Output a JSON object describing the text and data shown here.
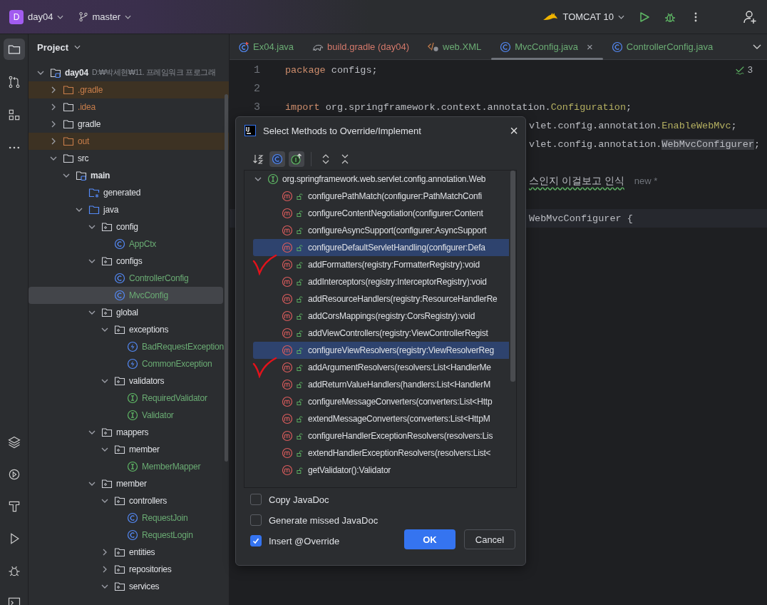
{
  "title_bar": {
    "project_badge": "D",
    "project": "day04",
    "branch": "master",
    "run_config": "TOMCAT 10"
  },
  "project_panel": {
    "title": "Project",
    "tree": [
      {
        "label": "day04",
        "kind": "module",
        "expanded": true,
        "hint": "D:₩박세현₩11. 프레임워크 프로그래",
        "selected": false,
        "excluded": false,
        "ignored": false,
        "added": false,
        "children": [
          {
            "label": ".gradle",
            "kind": "folder",
            "expanded": false,
            "selected": false,
            "excluded": true,
            "ignored": false,
            "added": false
          },
          {
            "label": ".idea",
            "kind": "folder",
            "expanded": false,
            "selected": false,
            "excluded": false,
            "ignored": true,
            "added": false
          },
          {
            "label": "gradle",
            "kind": "folder",
            "expanded": false,
            "selected": false,
            "excluded": false,
            "ignored": false,
            "added": false
          },
          {
            "label": "out",
            "kind": "folder",
            "expanded": false,
            "selected": false,
            "excluded": true,
            "ignored": false,
            "added": false
          },
          {
            "label": "src",
            "kind": "folder",
            "expanded": true,
            "selected": false,
            "excluded": false,
            "ignored": false,
            "added": false,
            "children": [
              {
                "label": "main",
                "kind": "module",
                "expanded": true,
                "selected": false,
                "excluded": false,
                "ignored": false,
                "added": false,
                "children": [
                  {
                    "label": "generated",
                    "kind": "generated-root",
                    "selected": false,
                    "excluded": false,
                    "ignored": false,
                    "added": false
                  },
                  {
                    "label": "java",
                    "kind": "source-root",
                    "expanded": true,
                    "selected": false,
                    "excluded": false,
                    "ignored": false,
                    "added": false,
                    "children": [
                      {
                        "label": "config",
                        "kind": "package",
                        "expanded": true,
                        "selected": false,
                        "excluded": false,
                        "ignored": false,
                        "added": false,
                        "children": [
                          {
                            "label": "AppCtx",
                            "kind": "class",
                            "selected": false,
                            "excluded": false,
                            "ignored": false,
                            "added": true
                          }
                        ]
                      },
                      {
                        "label": "configs",
                        "kind": "package",
                        "expanded": true,
                        "selected": false,
                        "excluded": false,
                        "ignored": false,
                        "added": false,
                        "children": [
                          {
                            "label": "ControllerConfig",
                            "kind": "class",
                            "selected": false,
                            "excluded": false,
                            "ignored": false,
                            "added": true
                          },
                          {
                            "label": "MvcConfig",
                            "kind": "class",
                            "selected": true,
                            "excluded": false,
                            "ignored": false,
                            "added": true
                          }
                        ]
                      },
                      {
                        "label": "global",
                        "kind": "package",
                        "expanded": true,
                        "selected": false,
                        "excluded": false,
                        "ignored": false,
                        "added": false,
                        "children": [
                          {
                            "label": "exceptions",
                            "kind": "package",
                            "expanded": true,
                            "selected": false,
                            "excluded": false,
                            "ignored": false,
                            "added": false,
                            "children": [
                              {
                                "label": "BadRequestException",
                                "kind": "exception",
                                "selected": false,
                                "excluded": false,
                                "ignored": false,
                                "added": true
                              },
                              {
                                "label": "CommonException",
                                "kind": "exception",
                                "selected": false,
                                "excluded": false,
                                "ignored": false,
                                "added": true
                              }
                            ]
                          },
                          {
                            "label": "validators",
                            "kind": "package",
                            "expanded": true,
                            "selected": false,
                            "excluded": false,
                            "ignored": false,
                            "added": false,
                            "children": [
                              {
                                "label": "RequiredValidator",
                                "kind": "interface",
                                "selected": false,
                                "excluded": false,
                                "ignored": false,
                                "added": true
                              },
                              {
                                "label": "Validator",
                                "kind": "interface",
                                "selected": false,
                                "excluded": false,
                                "ignored": false,
                                "added": true
                              }
                            ]
                          }
                        ]
                      },
                      {
                        "label": "mappers",
                        "kind": "package",
                        "expanded": true,
                        "selected": false,
                        "excluded": false,
                        "ignored": false,
                        "added": false,
                        "children": [
                          {
                            "label": "member",
                            "kind": "package",
                            "expanded": true,
                            "selected": false,
                            "excluded": false,
                            "ignored": false,
                            "added": false,
                            "children": [
                              {
                                "label": "MemberMapper",
                                "kind": "interface",
                                "selected": false,
                                "excluded": false,
                                "ignored": false,
                                "added": true
                              }
                            ]
                          }
                        ]
                      },
                      {
                        "label": "member",
                        "kind": "package",
                        "expanded": true,
                        "selected": false,
                        "excluded": false,
                        "ignored": false,
                        "added": false,
                        "children": [
                          {
                            "label": "controllers",
                            "kind": "package",
                            "expanded": true,
                            "selected": false,
                            "excluded": false,
                            "ignored": false,
                            "added": false,
                            "children": [
                              {
                                "label": "RequestJoin",
                                "kind": "class",
                                "selected": false,
                                "excluded": false,
                                "ignored": false,
                                "added": true
                              },
                              {
                                "label": "RequestLogin",
                                "kind": "class",
                                "selected": false,
                                "excluded": false,
                                "ignored": false,
                                "added": true
                              }
                            ]
                          },
                          {
                            "label": "entities",
                            "kind": "package",
                            "expanded": false,
                            "selected": false,
                            "excluded": false,
                            "ignored": false,
                            "added": false
                          },
                          {
                            "label": "repositories",
                            "kind": "package",
                            "expanded": false,
                            "selected": false,
                            "excluded": false,
                            "ignored": false,
                            "added": false
                          },
                          {
                            "label": "services",
                            "kind": "package",
                            "expanded": true,
                            "selected": false,
                            "excluded": false,
                            "ignored": false,
                            "added": false
                          }
                        ]
                      }
                    ]
                  }
                ]
              }
            ]
          }
        ]
      }
    ]
  },
  "editor": {
    "tabs": [
      {
        "label": "Ex04.java",
        "kind": "run-class",
        "added": true,
        "unversioned": false,
        "selected": false
      },
      {
        "label": "build.gradle (day04)",
        "kind": "gradle",
        "added": false,
        "unversioned": true,
        "selected": false
      },
      {
        "label": "web.XML",
        "kind": "xml",
        "added": true,
        "unversioned": false,
        "selected": false
      },
      {
        "label": "MvcConfig.java",
        "kind": "class",
        "added": true,
        "unversioned": false,
        "selected": true,
        "close": "×"
      },
      {
        "label": "ControllerConfig.java",
        "kind": "class",
        "added": true,
        "unversioned": false,
        "selected": false
      }
    ],
    "inspection_count": "3",
    "lines": [
      {
        "number": "1",
        "clipped": false,
        "current": false,
        "tokens": [
          {
            "text": "package",
            "kind": "keyword"
          },
          {
            "text": " configs;",
            "kind": "plain"
          }
        ]
      },
      {
        "number": "2",
        "current": false
      },
      {
        "number": "3",
        "clipped": false,
        "current": false,
        "tokens": [
          {
            "text": "import",
            "kind": "keyword"
          },
          {
            "text": " org.springframework.context.annotation.",
            "kind": "plain"
          },
          {
            "text": "Configuration",
            "kind": "annotation"
          },
          {
            "text": ";",
            "kind": "plain"
          }
        ]
      },
      {
        "clipped": true,
        "current": false,
        "tokens": [
          {
            "text": "vlet.config.annotation.",
            "kind": "plain"
          },
          {
            "text": "EnableWebMvc",
            "kind": "annotation"
          },
          {
            "text": ";",
            "kind": "plain"
          }
        ]
      },
      {
        "clipped": true,
        "current": false,
        "tokens": [
          {
            "text": "vlet.config.annotation.",
            "kind": "plain"
          },
          {
            "text": "WebMvcConfigurer",
            "kind": "marked"
          },
          {
            "text": ";",
            "kind": "plain"
          }
        ]
      },
      {
        "current": false
      },
      {
        "clipped": true,
        "current": false,
        "tokens": [
          {
            "text": "스인지 이걸보고 인식",
            "kind": "comment"
          }
        ],
        "inlay": "new *"
      },
      {
        "current": false
      },
      {
        "clipped": true,
        "current": true,
        "tokens": [
          {
            "text": "WebMvcConfigurer {",
            "kind": "plain"
          }
        ]
      }
    ]
  },
  "dialog": {
    "title": "Select Methods to Override/Implement",
    "close": "×",
    "toolbar": [
      {
        "kind": "sort",
        "on": false
      },
      {
        "kind": "class",
        "on": true
      },
      {
        "kind": "interface",
        "on": true
      },
      {
        "kind": "expand"
      },
      {
        "kind": "collapse"
      }
    ],
    "group": {
      "label": "org.springframework.web.servlet.config.annotation.Web",
      "expanded": true
    },
    "methods": [
      {
        "label": "configurePathMatch(configurer:PathMatchConfi",
        "selected": false
      },
      {
        "label": "configureContentNegotiation(configurer:Content",
        "selected": false
      },
      {
        "label": "configureAsyncSupport(configurer:AsyncSupport",
        "selected": false
      },
      {
        "label": "configureDefaultServletHandling(configurer:Defa",
        "selected": true
      },
      {
        "label": "addFormatters(registry:FormatterRegistry):void",
        "selected": false
      },
      {
        "label": "addInterceptors(registry:InterceptorRegistry):void",
        "selected": false
      },
      {
        "label": "addResourceHandlers(registry:ResourceHandlerRe",
        "selected": false
      },
      {
        "label": "addCorsMappings(registry:CorsRegistry):void",
        "selected": false
      },
      {
        "label": "addViewControllers(registry:ViewControllerRegist",
        "selected": false
      },
      {
        "label": "configureViewResolvers(registry:ViewResolverReg",
        "selected": true
      },
      {
        "label": "addArgumentResolvers(resolvers:List<HandlerMe",
        "selected": false
      },
      {
        "label": "addReturnValueHandlers(handlers:List<HandlerM",
        "selected": false
      },
      {
        "label": "configureMessageConverters(converters:List<Http",
        "selected": false
      },
      {
        "label": "extendMessageConverters(converters:List<HttpM",
        "selected": false
      },
      {
        "label": "configureHandlerExceptionResolvers(resolvers:Lis",
        "selected": false
      },
      {
        "label": "extendHandlerExceptionResolvers(resolvers:List<",
        "selected": false
      },
      {
        "label": "getValidator():Validator",
        "selected": false
      }
    ],
    "options": [
      {
        "label": "Copy JavaDoc",
        "checked": false
      },
      {
        "label": "Generate missed JavaDoc",
        "checked": false
      },
      {
        "label": "Insert @Override",
        "checked": true
      }
    ],
    "ok": "OK",
    "cancel": "Cancel"
  }
}
